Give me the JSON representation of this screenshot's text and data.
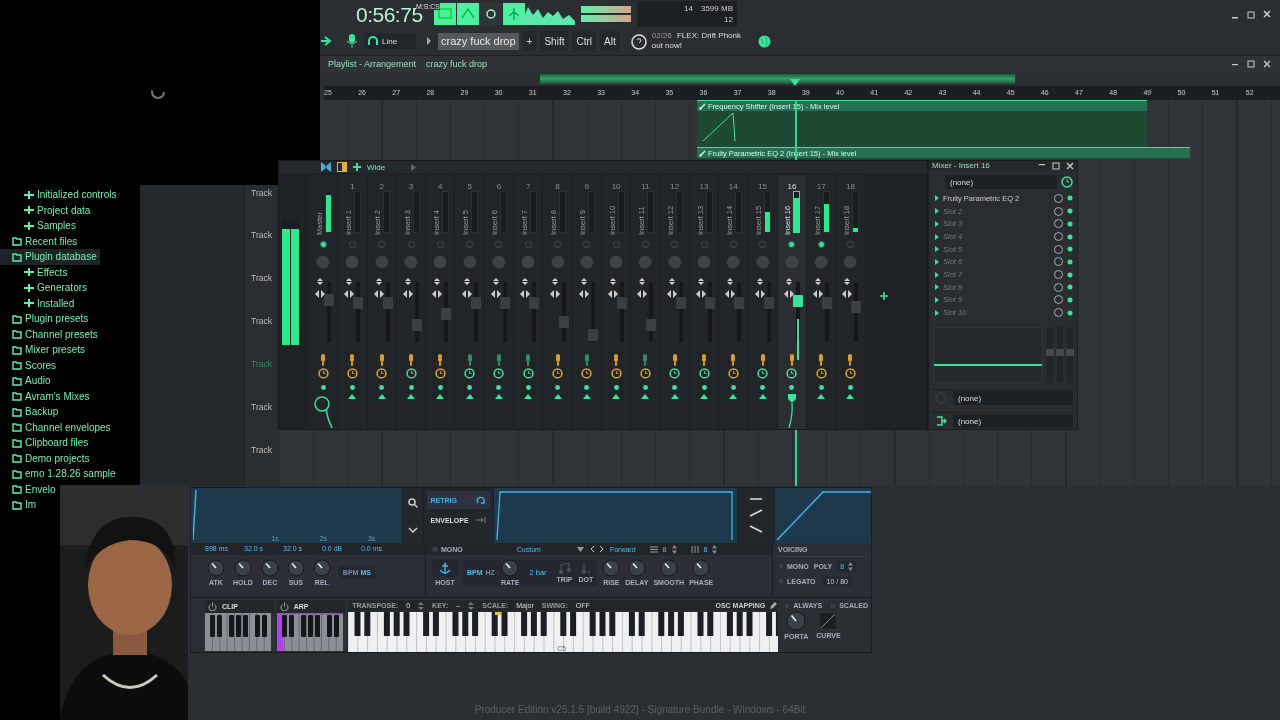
{
  "toolbar": {
    "time": "0:56:75",
    "time_unit": "M:S:CS",
    "mode_buttons": [
      {
        "on": true
      },
      {
        "on": true
      },
      {
        "on": false
      },
      {
        "on": true
      }
    ],
    "cpu": "14",
    "memory": "3599 MB",
    "polyphony": "12",
    "record_source": "Line",
    "pattern": "crazy fuck drop",
    "add_pattern": "+",
    "modifiers": [
      "Shift",
      "Ctrl",
      "Alt"
    ],
    "news_date": "02/26",
    "news_text": "FLEX: Drift Phonk out now!"
  },
  "playlist": {
    "title": "Playlist - Arrangement",
    "pattern": "crazy fuck drop",
    "ruler": [
      "25",
      "26",
      "27",
      "28",
      "29",
      "30",
      "31",
      "32",
      "33",
      "34",
      "35",
      "36",
      "37",
      "38",
      "39",
      "40",
      "41",
      "42",
      "43",
      "44",
      "45",
      "46",
      "47",
      "48",
      "49",
      "50",
      "51",
      "52"
    ],
    "clips": [
      {
        "label": "Frequency Shifter (Insert 15) - Mix level"
      },
      {
        "label": "Fruity Parametric EQ 2 (Insert 15) - Mix level"
      }
    ],
    "tracks": [
      {
        "label": "Track",
        "selected": false
      },
      {
        "label": "Track",
        "selected": false
      },
      {
        "label": "Track",
        "selected": false
      },
      {
        "label": "Track",
        "selected": false
      },
      {
        "label": "Track",
        "selected": true
      },
      {
        "label": "Track",
        "selected": false
      },
      {
        "label": "Track",
        "selected": false
      }
    ]
  },
  "browser": {
    "items": [
      {
        "children": [
          {
            "label": "Initialized controls",
            "selected": false
          },
          {
            "label": "Project data",
            "selected": false
          },
          {
            "label": "Samples",
            "selected": false
          }
        ]
      },
      {
        "label": "Recent files",
        "selected": false
      },
      {
        "label": "Plugin database",
        "selected": true,
        "children": [
          {
            "label": "Effects",
            "selected": false
          },
          {
            "label": "Generators",
            "selected": false
          },
          {
            "label": "Installed",
            "selected": false
          }
        ]
      },
      {
        "label": "Plugin presets",
        "selected": false
      },
      {
        "label": "Channel presets",
        "selected": false
      },
      {
        "label": "Mixer presets",
        "selected": false
      },
      {
        "label": "Scores",
        "selected": false
      },
      {
        "label": "Audio",
        "selected": false
      },
      {
        "label": "Avram's Mixes",
        "selected": false
      },
      {
        "label": "Backup",
        "selected": false
      },
      {
        "label": "Channel envelopes",
        "selected": false
      },
      {
        "label": "Clipboard files",
        "selected": false
      },
      {
        "label": "Demo projects",
        "selected": false
      },
      {
        "label": "emo 1.28.26 sample",
        "selected": false
      },
      {
        "label": "Envelo",
        "selected": false
      },
      {
        "label": "Im",
        "selected": false
      }
    ]
  },
  "mixer": {
    "preset": "Wide",
    "strips": [
      {
        "kind": "master",
        "label": "Master",
        "selected": false,
        "meter": {
          "level": 0.92
        },
        "fader": {
          "level": 0.69
        },
        "route_on": true,
        "switch": {
          "color": "#e0a030"
        },
        "fx": {
          "color": "#e0a030"
        }
      },
      {
        "kind": "insert",
        "number": "1",
        "label": "Insert 1",
        "selected": false,
        "fader": {
          "level": 0.65
        },
        "route_on": false,
        "switch": {
          "color": "#e0a030"
        },
        "fx": {
          "color": "#e0a030"
        }
      },
      {
        "kind": "insert",
        "number": "2",
        "label": "Insert 2",
        "selected": false,
        "fader": {
          "level": 0.65
        },
        "route_on": false,
        "switch": {
          "color": "#e0a030"
        },
        "fx": {
          "color": "#e0a030"
        }
      },
      {
        "kind": "insert",
        "number": "3",
        "label": "Insert 3",
        "selected": false,
        "fader": {
          "level": 0.28
        },
        "route_on": false,
        "switch": {
          "color": "#e0a030"
        },
        "fx": {
          "color": "#3ee0a0"
        }
      },
      {
        "kind": "insert",
        "number": "4",
        "label": "Insert 4",
        "selected": false,
        "fader": {
          "level": 0.46
        },
        "route_on": false,
        "switch": {
          "color": "#e0a030"
        },
        "fx": {
          "color": "#e0a030"
        }
      },
      {
        "kind": "insert",
        "number": "5",
        "label": "Insert 5",
        "selected": false,
        "fader": {
          "level": 0.65
        },
        "route_on": false,
        "switch": {
          "color": "#2f8f6a"
        },
        "fx": {
          "color": "#3ee0a0"
        }
      },
      {
        "kind": "insert",
        "number": "6",
        "label": "Insert 6",
        "selected": false,
        "fader": {
          "level": 0.65
        },
        "route_on": false,
        "switch": {
          "color": "#2f8f6a"
        },
        "fx": {
          "color": "#3ee0a0"
        }
      },
      {
        "kind": "insert",
        "number": "7",
        "label": "Insert 7",
        "selected": false,
        "fader": {
          "level": 0.65
        },
        "route_on": false,
        "switch": {
          "color": "#2f8f6a"
        },
        "fx": {
          "color": "#3ee0a0"
        }
      },
      {
        "kind": "insert",
        "number": "8",
        "label": "Insert 8",
        "selected": false,
        "fader": {
          "level": 0.34
        },
        "route_on": false,
        "switch": {
          "color": "#e0a030"
        },
        "fx": {
          "color": "#e0a030"
        }
      },
      {
        "kind": "insert",
        "number": "9",
        "label": "Insert 9",
        "selected": false,
        "fader": {
          "level": 0.12
        },
        "route_on": false,
        "switch": {
          "color": "#2f8f6a"
        },
        "fx": {
          "color": "#e0a030"
        }
      },
      {
        "kind": "insert",
        "number": "10",
        "label": "Insert 10",
        "selected": false,
        "fader": {
          "level": 0.65
        },
        "route_on": false,
        "switch": {
          "color": "#e0a030"
        },
        "fx": {
          "color": "#e0a030"
        }
      },
      {
        "kind": "insert",
        "number": "11",
        "label": "Insert 11",
        "selected": false,
        "fader": {
          "level": 0.28
        },
        "route_on": false,
        "switch": {
          "color": "#2f8f6a"
        },
        "fx": {
          "color": "#e0a030"
        }
      },
      {
        "kind": "insert",
        "number": "12",
        "label": "Insert 12",
        "selected": false,
        "fader": {
          "level": 0.65
        },
        "route_on": false,
        "switch": {
          "color": "#e0a030"
        },
        "fx": {
          "color": "#3ee0a0"
        }
      },
      {
        "kind": "insert",
        "number": "13",
        "label": "Insert 13",
        "selected": false,
        "fader": {
          "level": 0.65
        },
        "route_on": false,
        "switch": {
          "color": "#e0a030"
        },
        "fx": {
          "color": "#3ee0a0"
        }
      },
      {
        "kind": "insert",
        "number": "14",
        "label": "Insert 14",
        "selected": false,
        "fader": {
          "level": 0.65
        },
        "route_on": false,
        "switch": {
          "color": "#e0a030"
        },
        "fx": {
          "color": "#e0a030"
        }
      },
      {
        "kind": "insert",
        "number": "15",
        "label": "Insert 15",
        "selected": false,
        "meter": {
          "level": 0.5
        },
        "fader": {
          "level": 0.65
        },
        "route_on": false,
        "switch": {
          "color": "#e0a030"
        },
        "fx": {
          "color": "#3ee0a0"
        }
      },
      {
        "kind": "insert",
        "number": "16",
        "label": "Insert 16",
        "selected": true,
        "meter": {
          "level": 0.85
        },
        "fader": {
          "level": 0.69
        },
        "route_on": true,
        "switch": {
          "color": "#e0a030"
        },
        "fx": {
          "color": "#3ee0a0"
        }
      },
      {
        "kind": "insert",
        "number": "17",
        "label": "Insert 17",
        "selected": false,
        "meter": {
          "level": 0.7
        },
        "fader": {
          "level": 0.65
        },
        "route_on": true,
        "switch": {
          "color": "#e0a030"
        },
        "fx": {
          "color": "#e0a030"
        }
      },
      {
        "kind": "insert",
        "number": "18",
        "label": "Insert 18",
        "selected": false,
        "meter": {
          "level": 0.1
        },
        "fader": {
          "level": 0.58
        },
        "route_on": false,
        "switch": {
          "color": "#e0a030"
        },
        "fx": {
          "color": "#e0a030"
        }
      }
    ]
  },
  "insert_panel": {
    "title": "Mixer - Insert 16",
    "input": "(none)",
    "slots": [
      {
        "label": "Fruity Parametric EQ 2",
        "empty": false
      },
      {
        "label": "Slot 2",
        "empty": true
      },
      {
        "label": "Slot 3",
        "empty": true
      },
      {
        "label": "Slot 4",
        "empty": true
      },
      {
        "label": "Slot 5",
        "empty": true
      },
      {
        "label": "Slot 6",
        "empty": true
      },
      {
        "label": "Slot 7",
        "empty": true
      },
      {
        "label": "Slot 8",
        "empty": true
      },
      {
        "label": "Slot 9",
        "empty": true
      },
      {
        "label": "Slot 10",
        "empty": true
      }
    ],
    "outputs": [
      "(none)",
      "(none)"
    ]
  },
  "plugin": {
    "envelope": {
      "grid_labels": [
        "1s",
        "2s",
        "3s"
      ],
      "values": [
        "898 ms",
        "32.0 s",
        "32.0 s",
        "0.0 dB",
        "0.0 ms"
      ],
      "knobs": [
        {
          "label": "ATK"
        },
        {
          "label": "HOLD"
        },
        {
          "label": "DEC"
        },
        {
          "label": "SUS"
        },
        {
          "label": "REL"
        }
      ],
      "time_units": [
        "BPM",
        "MS"
      ]
    },
    "lfo": {
      "retrig": "RETRIG",
      "envelope": "ENVELOPE",
      "mono": {
        "label": "MONO",
        "checked": false
      },
      "shape": "Custom",
      "direction": "Forward",
      "steps": "8",
      "grid": "8",
      "host": "HOST",
      "rate_units": [
        "BPM",
        "HZ"
      ],
      "rate": {
        "label": "RATE"
      },
      "rate_value": "2 bar",
      "trip": "TRIP",
      "dot": "DOT",
      "knobs": [
        {
          "label": "RISE"
        },
        {
          "label": "DELAY"
        },
        {
          "label": "SMOOTH"
        },
        {
          "label": "PHASE"
        }
      ]
    },
    "voicing": {
      "title": "VOICING",
      "mono": {
        "label": "MONO",
        "checked": false
      },
      "poly": "POLY",
      "poly_value": "8",
      "legato": {
        "label": "LEGATO",
        "checked": false
      },
      "voices": "10 / 80"
    },
    "clip": "CLIP",
    "arp": "ARP",
    "keys": {
      "transpose_label": "TRANSPOSE:",
      "transpose": "0",
      "key_label": "KEY:",
      "key": "–",
      "scale_label": "SCALE:",
      "scale": "Major",
      "swing_label": "SWING:",
      "swing": "OFF",
      "osc_mapping": "OSC MAPPING",
      "octave_label": "C5"
    },
    "porta": {
      "always": {
        "label": "ALWAYS",
        "checked": false
      },
      "scaled": {
        "label": "SCALED",
        "checked": false
      },
      "porta": {
        "label": "PORTA"
      },
      "curve": "CURVE"
    }
  },
  "status": "Producer Edition v25.1.5 [build 4922] - Signature Bundle - Windows - 64Bit"
}
